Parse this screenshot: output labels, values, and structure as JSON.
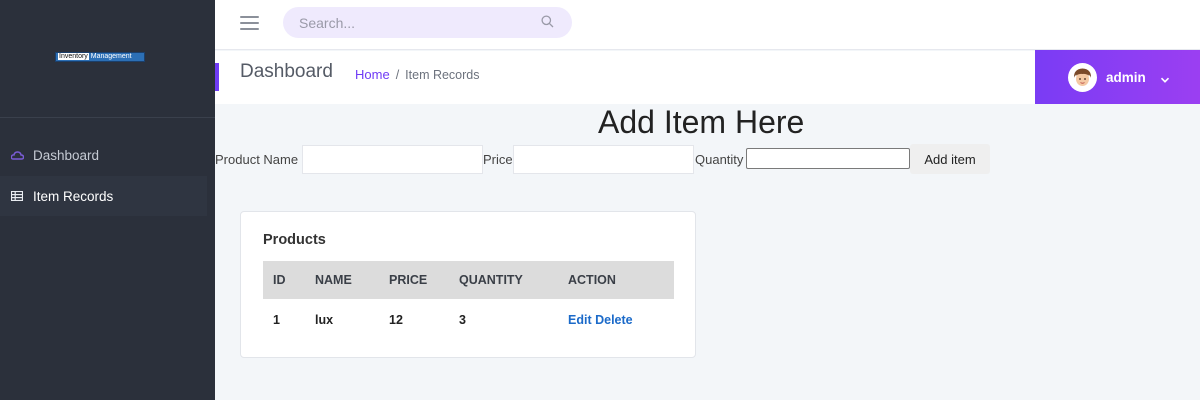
{
  "sidebar": {
    "logo": {
      "part1": "Inventory",
      "part2": "Management"
    },
    "items": [
      {
        "label": "Dashboard",
        "icon": "cloud-icon",
        "active": false
      },
      {
        "label": "Item Records",
        "icon": "table-icon",
        "active": true
      }
    ]
  },
  "topbar": {
    "search_placeholder": "Search..."
  },
  "header": {
    "title": "Dashboard",
    "breadcrumb": {
      "home": "Home",
      "separator": "/",
      "current": "Item Records"
    }
  },
  "user": {
    "name": "admin"
  },
  "form": {
    "title": "Add Item Here",
    "product_name_label": "Product Name",
    "price_label": "Price",
    "quantity_label": "Quantity",
    "product_name_value": "",
    "price_value": "",
    "quantity_value": "",
    "submit_label": "Add item"
  },
  "products": {
    "title": "Products",
    "columns": [
      "ID",
      "NAME",
      "PRICE",
      "QUANTITY",
      "ACTION"
    ],
    "rows": [
      {
        "id": "1",
        "name": "lux",
        "price": "12",
        "quantity": "3",
        "edit": "Edit",
        "delete": "Delete"
      }
    ]
  },
  "colors": {
    "accent": "#6f3bf5",
    "sidebar": "#2b303b",
    "link": "#1b6ac9"
  }
}
